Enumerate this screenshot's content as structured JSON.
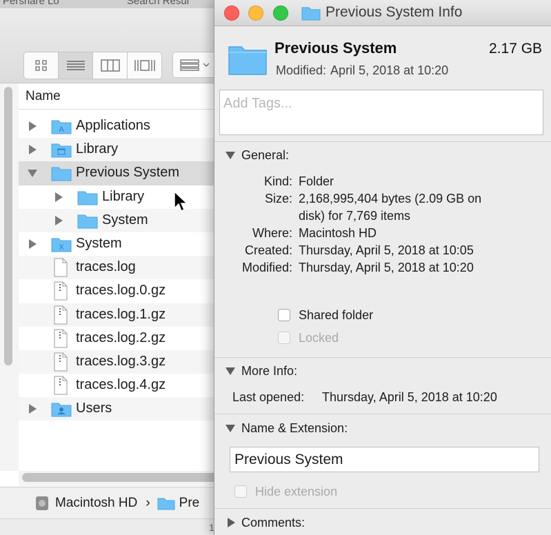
{
  "finder": {
    "tabs": [
      "Pershare Lo",
      "Search Resul"
    ],
    "column_header": "Name",
    "rows": [
      {
        "label": "Applications",
        "icon": "applications-folder-icon"
      },
      {
        "label": "Library",
        "icon": "library-folder-icon"
      },
      {
        "label": "Previous System",
        "icon": "folder-icon"
      },
      {
        "label": "Library",
        "icon": "folder-icon"
      },
      {
        "label": "System",
        "icon": "folder-icon"
      },
      {
        "label": "System",
        "icon": "system-folder-icon"
      },
      {
        "label": "traces.log",
        "icon": "document-icon"
      },
      {
        "label": "traces.log.0.gz",
        "icon": "archive-icon"
      },
      {
        "label": "traces.log.1.gz",
        "icon": "archive-icon"
      },
      {
        "label": "traces.log.2.gz",
        "icon": "archive-icon"
      },
      {
        "label": "traces.log.3.gz",
        "icon": "archive-icon"
      },
      {
        "label": "traces.log.4.gz",
        "icon": "archive-icon"
      },
      {
        "label": "Users",
        "icon": "users-folder-icon"
      }
    ],
    "path": {
      "disk": "Macintosh HD",
      "separator": "›",
      "folder": "Pre"
    },
    "status_partial": "1"
  },
  "info": {
    "window_title": "Previous System Info",
    "name": "Previous System",
    "size": "2.17 GB",
    "modified_label": "Modified:",
    "modified_value": "April 5, 2018 at 10:20",
    "tags_placeholder": "Add Tags...",
    "general": {
      "label": "General:",
      "kind_key": "Kind:",
      "kind_val": "Folder",
      "size_key": "Size:",
      "size_val_1": "2,168,995,404 bytes (2.09 GB on",
      "size_val_2": "disk) for 7,769 items",
      "where_key": "Where:",
      "where_val": "Macintosh HD",
      "created_key": "Created:",
      "created_val": "Thursday, April 5, 2018 at 10:05",
      "modified_key": "Modified:",
      "modified_val": "Thursday, April 5, 2018 at 10:20",
      "shared_label": "Shared folder",
      "locked_label": "Locked"
    },
    "more_info": {
      "label": "More Info:",
      "last_opened_key": "Last opened:",
      "last_opened_val": "Thursday, April 5, 2018 at 10:20"
    },
    "name_ext": {
      "label": "Name & Extension:",
      "value": "Previous System",
      "hide_ext_label": "Hide extension"
    },
    "comments": {
      "label": "Comments:"
    }
  },
  "colors": {
    "folder_blue": "#6cc0f5",
    "folder_blue_dark": "#4aa6e6"
  }
}
